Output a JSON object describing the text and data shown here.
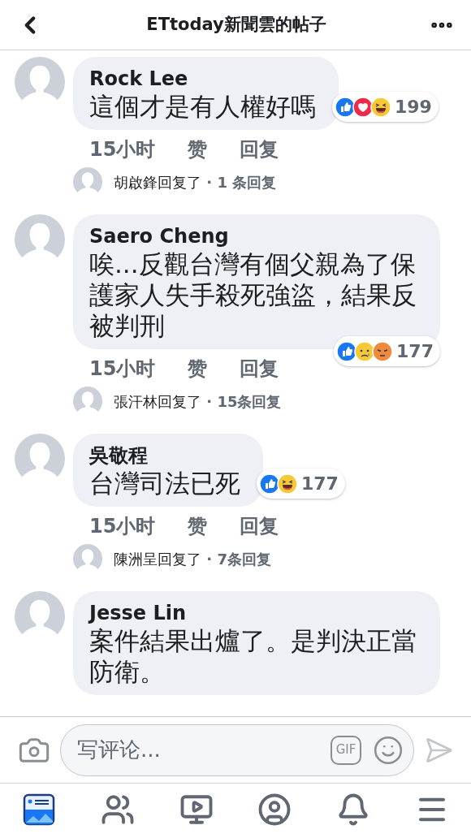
{
  "header": {
    "title": "ETtoday新聞雲的帖子"
  },
  "comments": [
    {
      "author": "Rock Lee",
      "text": "這個才是有人權好嗎",
      "reactions": {
        "kind": "side",
        "icons": [
          {
            "kind": "like"
          },
          {
            "kind": "love"
          },
          {
            "kind": "haha"
          }
        ],
        "count": "199"
      },
      "time": "15小时",
      "like_label": "赞",
      "reply_label": "回复",
      "replies": {
        "who": "胡啟鋒回复了",
        "count": "· 1 条回复"
      }
    },
    {
      "author": "Saero Cheng",
      "text": "唉...反觀台灣有個父親為了保護家人失手殺死強盜，結果反被判刑",
      "reactions": {
        "kind": "below",
        "icons": [
          {
            "kind": "like"
          },
          {
            "kind": "sad"
          },
          {
            "kind": "angry"
          }
        ],
        "count": "177"
      },
      "time": "15小时",
      "like_label": "赞",
      "reply_label": "回复",
      "replies": {
        "who": "張汗林回复了",
        "count": "· 15条回复"
      }
    },
    {
      "author": "吳敬程",
      "text": "台灣司法已死",
      "reactions": {
        "kind": "side",
        "icons": [
          {
            "kind": "like"
          },
          {
            "kind": "haha"
          }
        ],
        "count": "177"
      },
      "time": "15小时",
      "like_label": "赞",
      "reply_label": "回复",
      "replies": {
        "who": "陳洲呈回复了",
        "count": "· 7条回复"
      }
    },
    {
      "author": "Jesse Lin",
      "text": "案件結果出爐了。是判決正當防衛。"
    }
  ],
  "composer": {
    "placeholder": "写评论...",
    "gif_label": "GIF"
  },
  "nav": [
    {
      "kind": "feed",
      "selected": true
    },
    {
      "kind": "friends",
      "selected": false
    },
    {
      "kind": "watch",
      "selected": false
    },
    {
      "kind": "profile",
      "selected": false
    },
    {
      "kind": "notifications",
      "selected": false
    },
    {
      "kind": "menu",
      "selected": false
    }
  ]
}
